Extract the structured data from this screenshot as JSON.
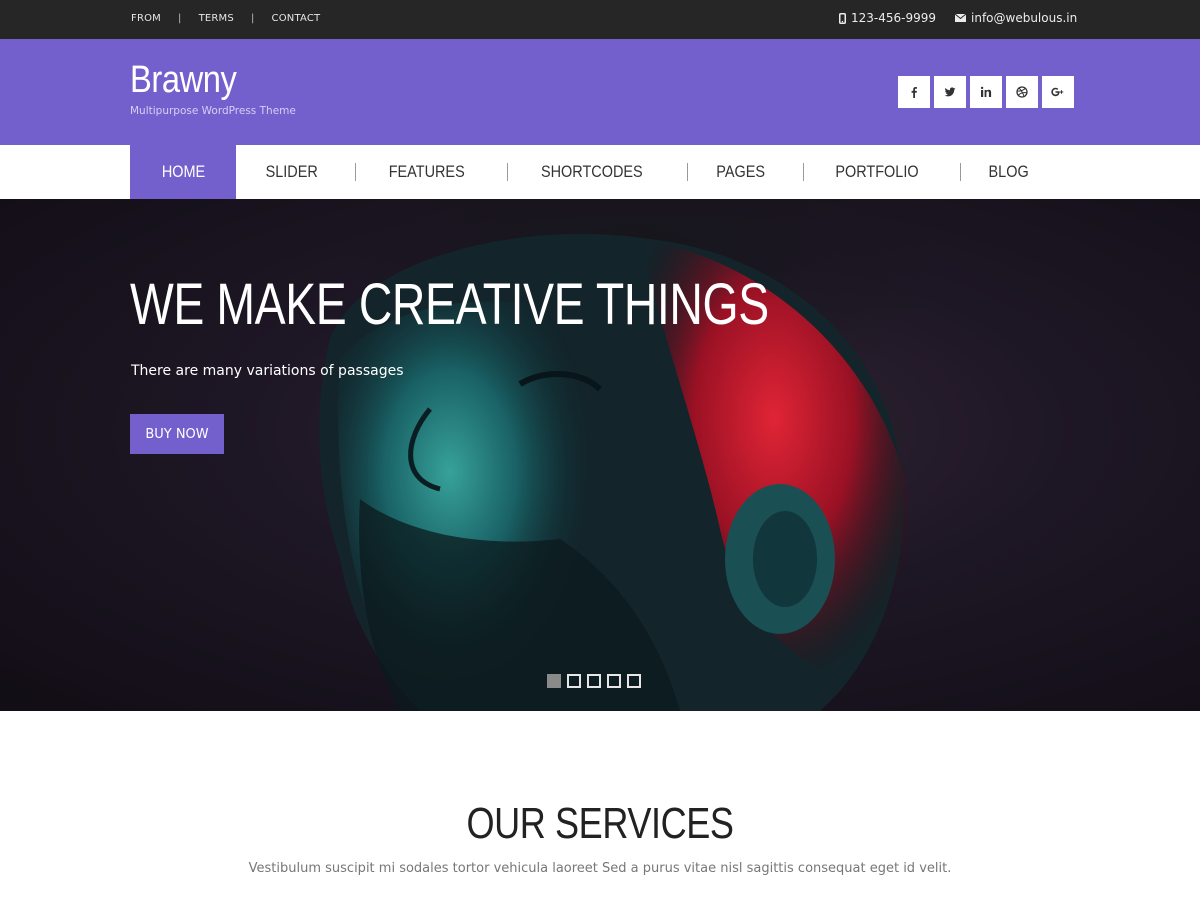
{
  "topbar": {
    "links": [
      "FROM",
      "TERMS",
      "CONTACT"
    ],
    "phone": "123-456-9999",
    "email": "info@webulous.in"
  },
  "header": {
    "brand_name": "Brawny",
    "tagline": "Multipurpose WordPress Theme",
    "social": [
      {
        "icon": "facebook-icon",
        "glyph": "f"
      },
      {
        "icon": "twitter-icon",
        "glyph": "t"
      },
      {
        "icon": "linkedin-icon",
        "glyph": "in"
      },
      {
        "icon": "dribbble-icon",
        "glyph": ""
      },
      {
        "icon": "google-plus-icon",
        "glyph": "g+"
      }
    ]
  },
  "nav": {
    "items": [
      {
        "label": "HOME",
        "active": true
      },
      {
        "label": "SLIDER"
      },
      {
        "label": "FEATURES"
      },
      {
        "label": "SHORTCODES"
      },
      {
        "label": "PAGES"
      },
      {
        "label": "PORTFOLIO"
      },
      {
        "label": "BLOG"
      }
    ]
  },
  "hero": {
    "title": "WE MAKE CREATIVE THINGS",
    "subtitle": "There are many variations of passages",
    "button": "BUY NOW",
    "slides": 5,
    "active_slide": 1
  },
  "services": {
    "title": "OUR SERVICES",
    "text": "Vestibulum suscipit mi sodales tortor vehicula laoreet Sed a purus vitae nisl sagittis consequat eget id velit."
  },
  "colors": {
    "accent": "#7460cd",
    "topbar": "#262626"
  }
}
